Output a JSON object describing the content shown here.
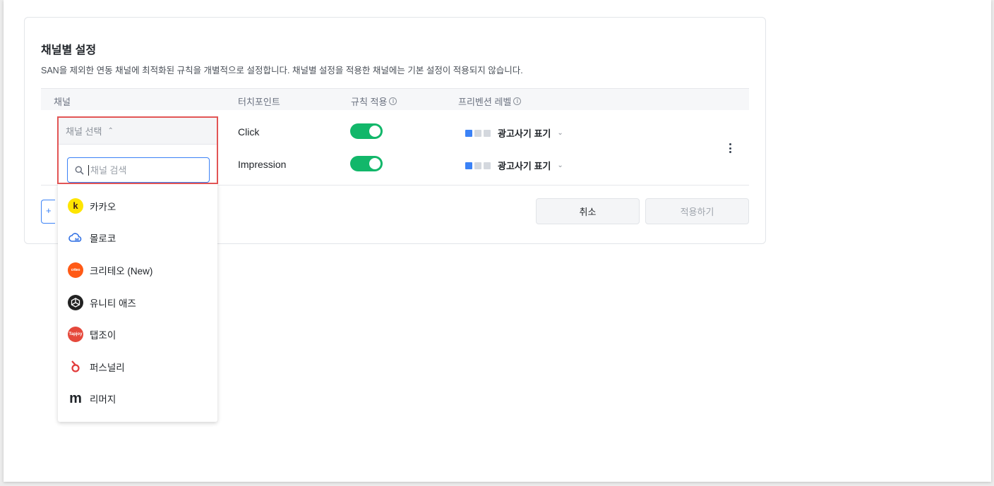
{
  "section": {
    "title": "채널별 설정",
    "description": "SAN을 제외한 연동 채널에 최적화된 규칙을 개별적으로 설정합니다. 채널별 설정을 적용한 채널에는 기본 설정이 적용되지 않습니다."
  },
  "table": {
    "headers": {
      "channel": "채널",
      "touchpoint": "터치포인트",
      "rule": "규칙 적용",
      "prevention": "프리벤션 레벨"
    },
    "rows": [
      {
        "touchpoint": "Click",
        "rule_on": true,
        "level_label": "광고사기 표기",
        "level": 1
      },
      {
        "touchpoint": "Impression",
        "rule_on": true,
        "level_label": "광고사기 표기",
        "level": 1
      }
    ]
  },
  "channel_dropdown": {
    "selector_label": "채널 선택",
    "search_placeholder": "채널 검색",
    "options": [
      {
        "label": "카카오",
        "icon": "kakao-logo"
      },
      {
        "label": "몰로코",
        "icon": "moloco-logo"
      },
      {
        "label": "크리테오 (New)",
        "icon": "criteo-logo"
      },
      {
        "label": "유니티 애즈",
        "icon": "unity-logo"
      },
      {
        "label": "탭조이",
        "icon": "tapjoy-logo"
      },
      {
        "label": "퍼스널리",
        "icon": "persona-logo"
      },
      {
        "label": "리머지",
        "icon": "remerge-logo"
      }
    ]
  },
  "logos": {
    "kakao": "k",
    "criteo": "criteo",
    "tapjoy": "Tapjoy",
    "remerge": "m"
  },
  "buttons": {
    "cancel": "취소",
    "apply": "적용하기"
  },
  "colors": {
    "toggle_on": "#12b76a",
    "level_active": "#3b82f6",
    "focus_border": "#e25555"
  }
}
